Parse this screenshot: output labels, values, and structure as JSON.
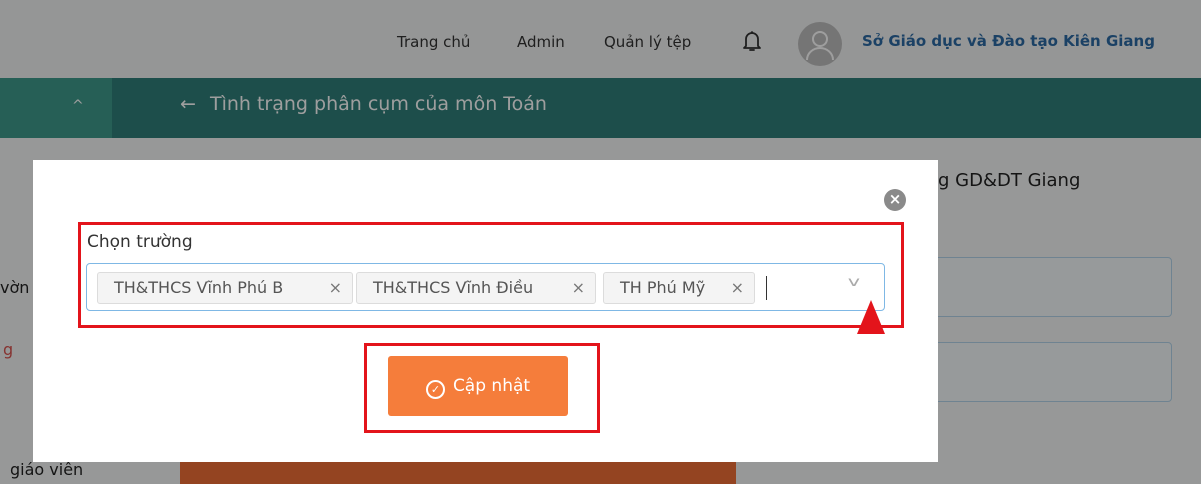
{
  "topnav": {
    "home": "Trang chủ",
    "admin": "Admin",
    "files": "Quản lý tệp",
    "organization": "Sở Giáo dục và Đào tạo Kiên Giang"
  },
  "header": {
    "back_arrow": "←",
    "title": "Tình trạng phân cụm của môn Toán",
    "collapse_caret": "^"
  },
  "background": {
    "sidebar_fragment_1": "vờn",
    "sidebar_fragment_2": "g",
    "sidebar_fragment_3": "giáo viên",
    "right_text": "g GD&DT Giang"
  },
  "modal": {
    "close_glyph": "×",
    "field_label": "Chọn trường",
    "selected_schools": [
      {
        "label": "TH&THCS Vĩnh Phú B",
        "remove": "×"
      },
      {
        "label": "TH&THCS Vĩnh Điều",
        "remove": "×"
      },
      {
        "label": "TH Phú Mỹ",
        "remove": "×"
      }
    ],
    "dropdown_glyph": "v",
    "update_button": {
      "icon": "✓",
      "label": "Cập nhật"
    }
  },
  "colors": {
    "accent_teal": "#2f7f7a",
    "button_orange": "#f57d3b",
    "highlight_red": "#e3141b",
    "link_blue": "#2c6aa3"
  },
  "icons": [
    "bell-icon",
    "user-avatar-icon",
    "close-icon",
    "tag-remove-icon",
    "chevron-down-icon",
    "check-circle-icon",
    "arrow-left-icon"
  ]
}
